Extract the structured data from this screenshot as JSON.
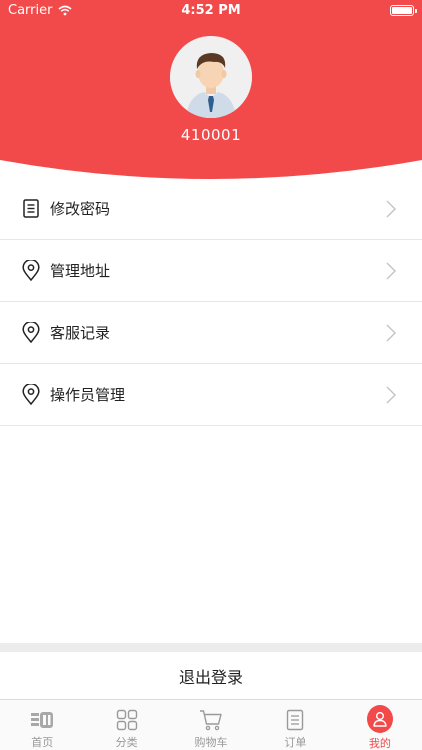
{
  "status_bar": {
    "carrier": "Carrier",
    "time": "4:52 PM"
  },
  "profile": {
    "user_id": "410001"
  },
  "menu": [
    {
      "label": "修改密码",
      "icon": "document-icon"
    },
    {
      "label": "管理地址",
      "icon": "location-pin-icon"
    },
    {
      "label": "客服记录",
      "icon": "location-pin-icon"
    },
    {
      "label": "操作员管理",
      "icon": "location-pin-icon"
    }
  ],
  "logout_label": "退出登录",
  "tabbar": [
    {
      "label": "首页",
      "icon": "home-logo-icon",
      "active": false
    },
    {
      "label": "分类",
      "icon": "grid-icon",
      "active": false
    },
    {
      "label": "购物车",
      "icon": "cart-icon",
      "active": false
    },
    {
      "label": "订单",
      "icon": "order-list-icon",
      "active": false
    },
    {
      "label": "我的",
      "icon": "user-icon",
      "active": true
    }
  ],
  "colors": {
    "accent": "#f24a4a",
    "header": "#f24a4a"
  }
}
